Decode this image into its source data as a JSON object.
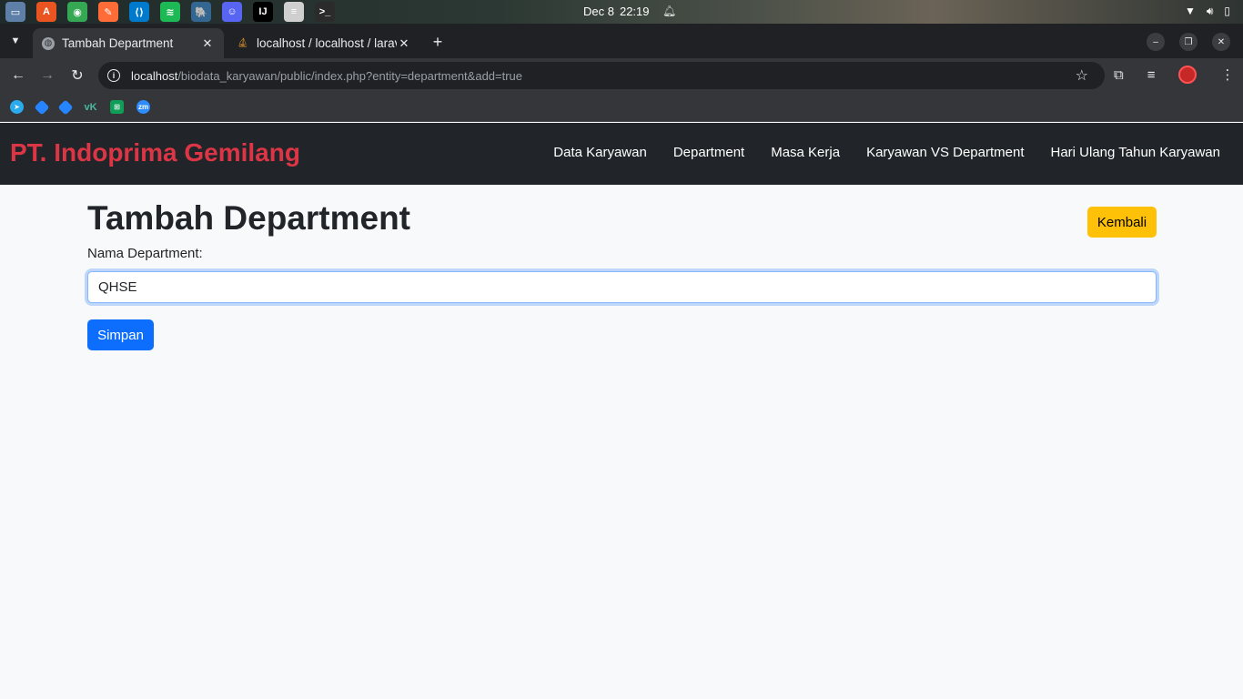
{
  "os": {
    "date": "Dec 8",
    "time": "22:19",
    "apps": [
      {
        "name": "files-app-icon",
        "color": "#5e7fa8",
        "glyph": "▭"
      },
      {
        "name": "software-center-icon",
        "color": "#e95420",
        "glyph": "A"
      },
      {
        "name": "chrome-icon",
        "color": "#34a853",
        "glyph": "◉"
      },
      {
        "name": "postman-icon",
        "color": "#ff6c37",
        "glyph": "✎"
      },
      {
        "name": "vscode-icon",
        "color": "#007acc",
        "glyph": "⟨⟩"
      },
      {
        "name": "spotify-icon",
        "color": "#1db954",
        "glyph": "≋"
      },
      {
        "name": "postgres-icon",
        "color": "#336791",
        "glyph": "🐘"
      },
      {
        "name": "discord-icon",
        "color": "#5865f2",
        "glyph": "☺"
      },
      {
        "name": "intellij-icon",
        "color": "#000000",
        "glyph": "IJ"
      },
      {
        "name": "text-editor-icon",
        "color": "#cfcfcf",
        "glyph": "≡"
      },
      {
        "name": "terminal-icon",
        "color": "#2b2b2b",
        "glyph": ">_"
      }
    ]
  },
  "browser": {
    "tabs": [
      {
        "title": "Tambah Department",
        "active": true
      },
      {
        "title": "localhost / localhost / laravel",
        "active": false
      }
    ],
    "url_host": "localhost",
    "url_path": "/biodata_karyawan/public/index.php?entity=department&add=true"
  },
  "navbar": {
    "brand": "PT. Indoprima Gemilang",
    "links": [
      "Data Karyawan",
      "Department",
      "Masa Kerja",
      "Karyawan VS Department",
      "Hari Ulang Tahun Karyawan"
    ]
  },
  "form": {
    "title": "Tambah Department",
    "back_label": "Kembali",
    "field_label": "Nama Department:",
    "field_value": "QHSE",
    "submit_label": "Simpan"
  },
  "colors": {
    "brand": "#dc3545",
    "navbar_bg": "#212529",
    "primary": "#0d6efd",
    "warning": "#ffc107"
  }
}
